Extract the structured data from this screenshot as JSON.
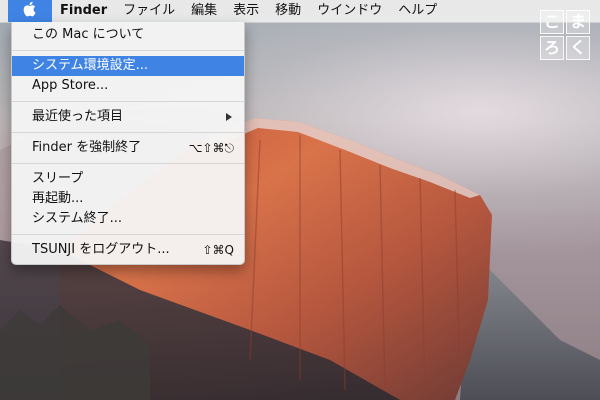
{
  "menubar": {
    "apple_icon": "apple-icon",
    "items": [
      {
        "label": "Finder"
      },
      {
        "label": "ファイル"
      },
      {
        "label": "編集"
      },
      {
        "label": "表示"
      },
      {
        "label": "移動"
      },
      {
        "label": "ウインドウ"
      },
      {
        "label": "ヘルプ"
      }
    ]
  },
  "apple_menu": {
    "items": [
      {
        "label": "この Mac について"
      },
      {
        "label": "システム環境設定..."
      },
      {
        "label": "App Store..."
      },
      {
        "label": "最近使った項目"
      },
      {
        "label": "Finder を強制終了",
        "shortcut": "⌥⇧⌘⎋"
      },
      {
        "label": "スリープ"
      },
      {
        "label": "再起動..."
      },
      {
        "label": "システム終了..."
      },
      {
        "label": "TSUNJI をログアウト...",
        "shortcut": "⇧⌘Q"
      }
    ],
    "highlight_color": "#3f84e5"
  },
  "watermark": {
    "chars": [
      "こ",
      "ま",
      "ろ",
      "く"
    ]
  },
  "colors": {
    "accent": "#3f84e5",
    "menubar_bg": "#eeeeee"
  }
}
